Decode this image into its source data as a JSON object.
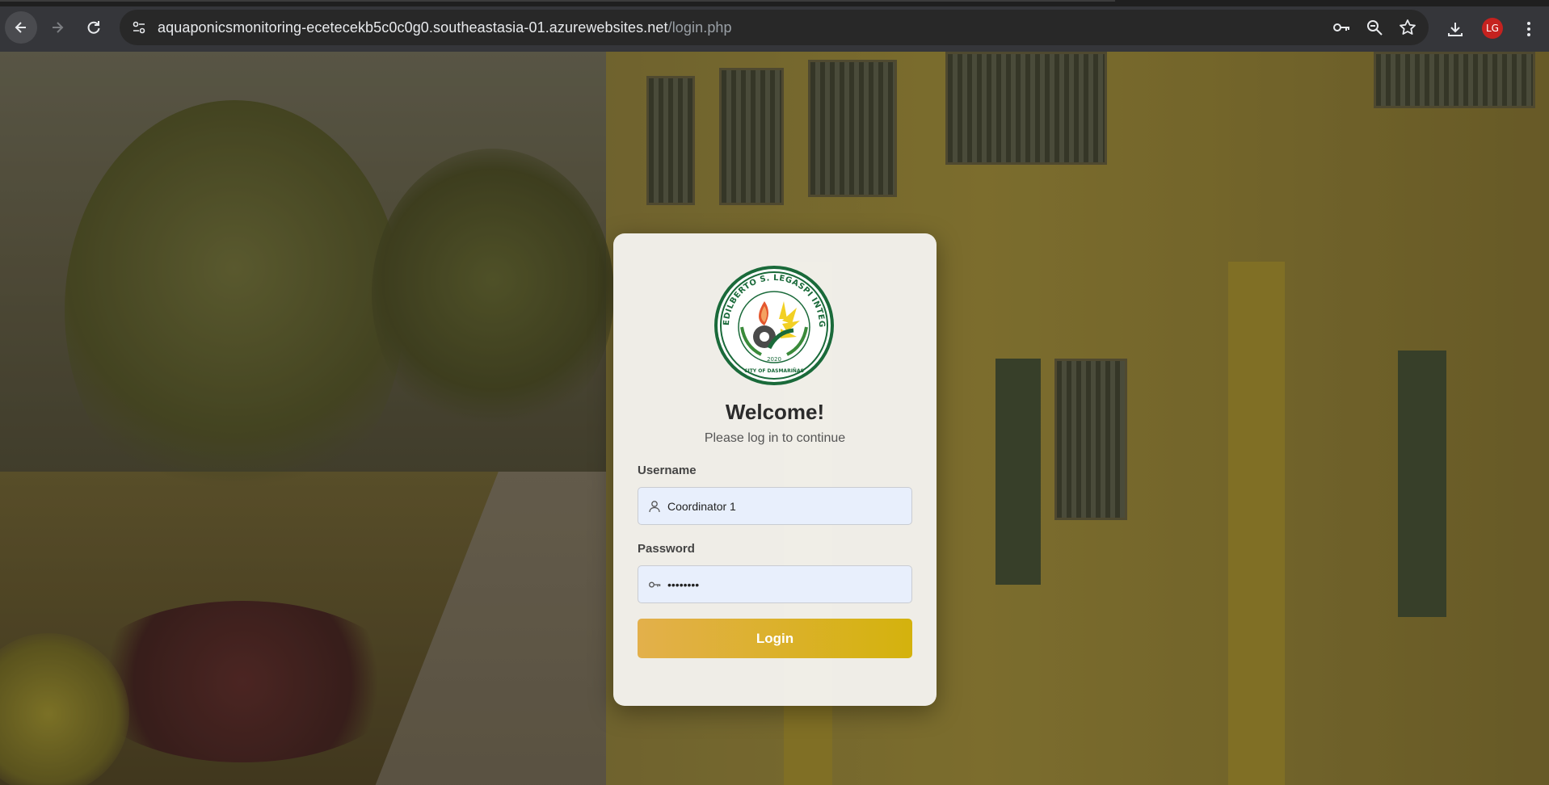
{
  "browser": {
    "url_host": "aquaponicsmonitoring-ecetecekb5c0c0g0.southeastasia-01.azurewebsites.net",
    "url_path": "/login.php",
    "profile_initials": "LG",
    "profile_color": "#c5221f",
    "icons": [
      "back-icon",
      "forward-icon",
      "reload-icon",
      "site-info-icon",
      "password-key-icon",
      "zoom-icon",
      "bookmark-star-icon",
      "download-icon",
      "menu-dots-icon"
    ]
  },
  "login": {
    "logo_text": "EDILBERTO S. LEGASPI INTEGRATED HIGH SCHOOL",
    "logo_city": "CITY OF DASMARIÑAS",
    "logo_year": "2020",
    "title": "Welcome!",
    "subtitle": "Please log in to continue",
    "username_label": "Username",
    "username_value": "Coordinator 1",
    "password_label": "Password",
    "password_value": "password",
    "button_label": "Login",
    "button_colors": [
      "#e3b04b",
      "#d4b20d"
    ]
  }
}
